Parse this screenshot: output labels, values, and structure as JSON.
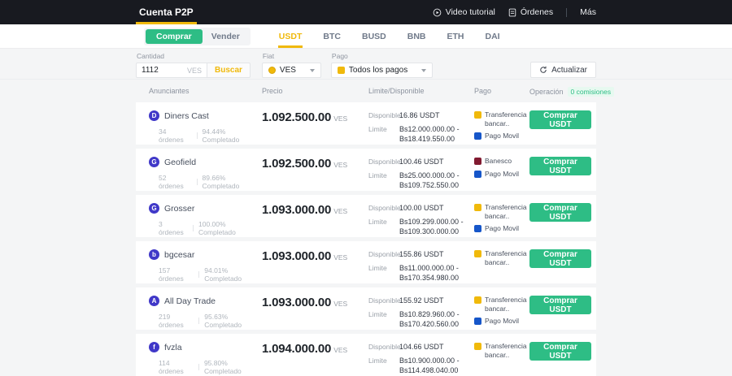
{
  "colors": {
    "brand_yellow": "#F0B90B",
    "buy_green": "#2EBD85",
    "topbar_bg": "#181A20",
    "page_bg": "#F4F5F6",
    "badge_green_bg": "#E7F9F0",
    "avatar_bg": "#4038C8",
    "payment_yellow": "#F0B90B",
    "payment_blue": "#1656C9",
    "payment_maroon": "#811A30"
  },
  "topbar": {
    "title": "Cuenta P2P",
    "links": {
      "video_tutorial": "Video tutorial",
      "ordenes": "Órdenes",
      "mas": "Más"
    }
  },
  "trade_tabs": {
    "buy": "Comprar",
    "sell": "Vender"
  },
  "asset_tabs": [
    "USDT",
    "BTC",
    "BUSD",
    "BNB",
    "ETH",
    "DAI"
  ],
  "filters": {
    "amount_label": "Cantidad",
    "amount_value": "1112",
    "amount_suffix": "VES",
    "search_button": "Buscar",
    "fiat_label": "Fiat",
    "fiat_selected": "VES",
    "payment_label": "Pago",
    "payment_selected": "Todos los pagos",
    "refresh_button": "Actualizar"
  },
  "table": {
    "headers": {
      "advertisers": "Anunciantes",
      "price": "Precio",
      "limit_available": "Limite/Disponible",
      "payment": "Pago",
      "operation": "Operación"
    },
    "zero_fee_badge": "0 comisiones",
    "available_label": "Disponible",
    "limit_label": "Limite",
    "buy_button": "Comprar USDT",
    "rows": [
      {
        "initial": "D",
        "name": "Diners Cast",
        "orders": "34 órdenes",
        "completion": "94.44% Completado",
        "price": "1.092.500.00",
        "currency": "VES",
        "available": "16.86 USDT",
        "limit_min": "Bs12.000.000.00",
        "limit_max": "Bs18.419.550.00",
        "payments": [
          {
            "label": "Transferencia bancar..",
            "color": "#F0B90B"
          },
          {
            "label": "Pago Movil",
            "color": "#1656C9"
          }
        ]
      },
      {
        "initial": "G",
        "name": "Geofield",
        "orders": "52 órdenes",
        "completion": "89.66% Completado",
        "price": "1.092.500.00",
        "currency": "VES",
        "available": "100.46 USDT",
        "limit_min": "Bs25.000.000.00",
        "limit_max": "Bs109.752.550.00",
        "payments": [
          {
            "label": "Banesco",
            "color": "#811A30"
          },
          {
            "label": "Pago Movil",
            "color": "#1656C9"
          }
        ]
      },
      {
        "initial": "G",
        "name": "Grosser",
        "orders": "3 órdenes",
        "completion": "100.00% Completado",
        "price": "1.093.000.00",
        "currency": "VES",
        "available": "100.00 USDT",
        "limit_min": "Bs109.299.000.00",
        "limit_max": "Bs109.300.000.00",
        "payments": [
          {
            "label": "Transferencia bancar..",
            "color": "#F0B90B"
          },
          {
            "label": "Pago Movil",
            "color": "#1656C9"
          }
        ]
      },
      {
        "initial": "b",
        "name": "bgcesar",
        "orders": "157 órdenes",
        "completion": "94.01% Completado",
        "price": "1.093.000.00",
        "currency": "VES",
        "available": "155.86 USDT",
        "limit_min": "Bs11.000.000.00",
        "limit_max": "Bs170.354.980.00",
        "payments": [
          {
            "label": "Transferencia bancar..",
            "color": "#F0B90B"
          }
        ]
      },
      {
        "initial": "A",
        "name": "All Day Trade",
        "orders": "219 órdenes",
        "completion": "95.63% Completado",
        "price": "1.093.000.00",
        "currency": "VES",
        "available": "155.92 USDT",
        "limit_min": "Bs10.829.960.00",
        "limit_max": "Bs170.420.560.00",
        "payments": [
          {
            "label": "Transferencia bancar..",
            "color": "#F0B90B"
          },
          {
            "label": "Pago Movil",
            "color": "#1656C9"
          }
        ]
      },
      {
        "initial": "f",
        "name": "fvzla",
        "orders": "114 órdenes",
        "completion": "95.80% Completado",
        "price": "1.094.000.00",
        "currency": "VES",
        "available": "104.66 USDT",
        "limit_min": "Bs10.900.000.00",
        "limit_max": "Bs114.498.040.00",
        "payments": [
          {
            "label": "Transferencia bancar..",
            "color": "#F0B90B"
          }
        ]
      }
    ]
  }
}
